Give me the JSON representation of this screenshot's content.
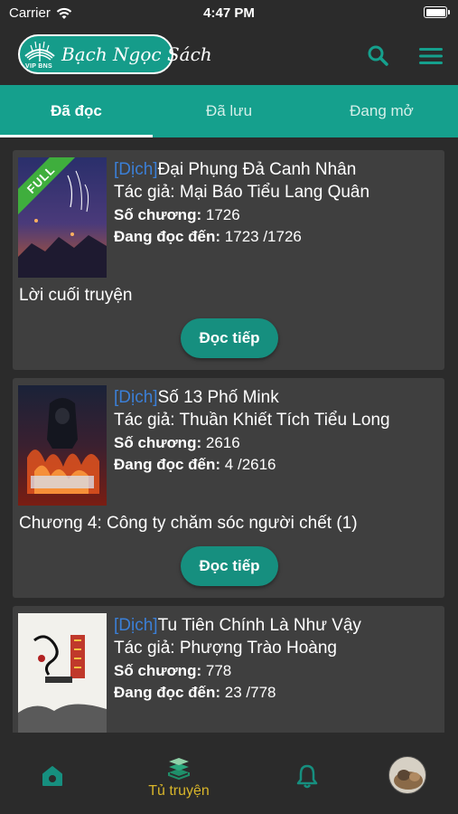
{
  "status_bar": {
    "carrier": "Carrier",
    "time": "4:47 PM"
  },
  "header": {
    "logo_text": "Bạch Ngọc Sách",
    "logo_badge": "VIP BNS",
    "icons": [
      "search-icon",
      "menu-icon"
    ]
  },
  "tabs": [
    {
      "label": "Đã đọc",
      "active": true
    },
    {
      "label": "Đã lưu",
      "active": false
    },
    {
      "label": "Đang mở",
      "active": false
    }
  ],
  "books": [
    {
      "tag": "[Dịch]",
      "title": "Đại Phụng Đả Canh Nhân",
      "author_line": "Tác giả: Mại Báo Tiểu Lang Quân",
      "chapters_label": "Số chương:",
      "chapters": "1726",
      "progress_label": "Đang đọc đến:",
      "progress": "1723 /1726",
      "badge": "FULL",
      "last_chapter": "Lời cuối truyện",
      "button": "Đọc tiếp"
    },
    {
      "tag": "[Dịch]",
      "title": "Số 13 Phố Mink",
      "author_line": "Tác giả: Thuần Khiết Tích Tiểu Long",
      "chapters_label": "Số chương:",
      "chapters": "2616",
      "progress_label": "Đang đọc đến:",
      "progress": "4 /2616",
      "last_chapter": "Chương 4: Công ty chăm sóc người chết (1)",
      "button": "Đọc tiếp"
    },
    {
      "tag": "[Dịch]",
      "title": "Tu Tiên Chính Là Như Vậy",
      "author_line": "Tác giả: Phượng Trào Hoàng",
      "chapters_label": "Số chương:",
      "chapters": "778",
      "progress_label": "Đang đọc đến:",
      "progress": "23 /778"
    }
  ],
  "bottom_nav": {
    "items": [
      {
        "icon": "home-icon",
        "label": ""
      },
      {
        "icon": "bookshelf-icon",
        "label": "Tủ truyện",
        "active": true
      },
      {
        "icon": "bell-icon",
        "label": ""
      },
      {
        "icon": "avatar",
        "label": ""
      }
    ]
  },
  "colors": {
    "accent": "#15a08d",
    "background": "#2b2b2b",
    "card": "#3f3f3f",
    "tag": "#3b7fd6",
    "active_nav": "#d8b52a",
    "full_badge": "#3fae3d"
  }
}
